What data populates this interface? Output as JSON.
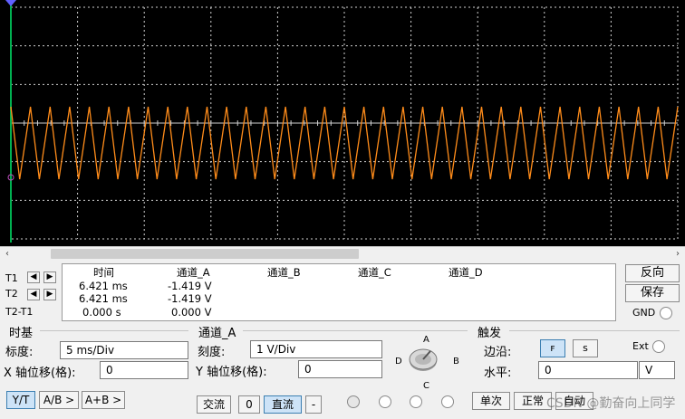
{
  "scope": {
    "trace_color": "#ff8c1a",
    "grid_color": "#d0d0d0",
    "cursor1_color": "#00b050",
    "cursor2_color": "#6060ff",
    "background": "#000000"
  },
  "cursor_buttons": {
    "t1": "T1",
    "t2": "T2",
    "t2t1": "T2-T1",
    "left_arrow": "◀",
    "right_arrow": "▶"
  },
  "readout": {
    "headers": [
      "时间",
      "通道_A",
      "通道_B",
      "通道_C",
      "通道_D"
    ],
    "rows": [
      {
        "time": "6.421 ms",
        "a": "-1.419 V"
      },
      {
        "time": "6.421 ms",
        "a": "-1.419 V"
      },
      {
        "time": "0.000 s",
        "a": "0.000 V"
      }
    ]
  },
  "side": {
    "reverse": "反向",
    "save": "保存",
    "gnd": "GND"
  },
  "timebase": {
    "title": "时基",
    "scale_label": "标度:",
    "scale_value": "5 ms/Div",
    "xpos_label": "X 轴位移(格):",
    "xpos_value": "0",
    "yt": "Y/T",
    "ab": "A/B >",
    "apb": "A+B >"
  },
  "channel_a": {
    "title": "通道_A",
    "scale_label": "刻度:",
    "scale_value": "1  V/Div",
    "ypos_label": "Y 轴位移(格):",
    "ypos_value": "0",
    "ac": "交流",
    "zero": "0",
    "dc": "直流",
    "minus": "-",
    "knob_a": "A",
    "knob_b": "B",
    "knob_c": "C",
    "knob_d": "D"
  },
  "trigger": {
    "title": "触发",
    "edge_label": "边沿:",
    "rise": "ꜰ",
    "fall": "ꜱ",
    "ext": "Ext",
    "level_label": "水平:",
    "level_value": "0",
    "level_unit": "V",
    "single": "单次",
    "normal": "正常",
    "auto": "自动"
  },
  "watermark": "CSDN @勤奋向上同学",
  "scrollbar": {
    "right_arrow": "›",
    "left_arrow": "‹"
  }
}
